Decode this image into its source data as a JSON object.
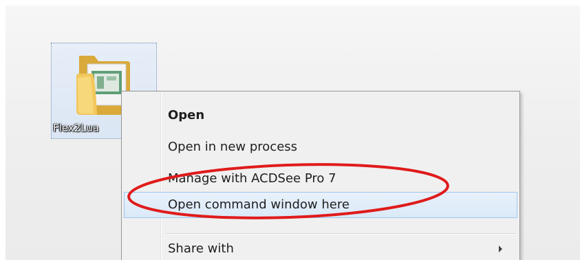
{
  "desktop": {
    "icon": {
      "label": "Flex2Lua",
      "icon": "folder-icon"
    }
  },
  "context_menu": {
    "items": [
      {
        "label": "Open",
        "bold": true
      },
      {
        "label": "Open in new process"
      },
      {
        "label": "Manage with ACDSee Pro 7"
      },
      {
        "label": "Open command window here",
        "highlighted": true
      },
      {
        "label": "Share with",
        "submenu": true
      }
    ]
  },
  "annotation": {
    "shape": "ellipse",
    "color": "#e01b1b",
    "target": "Open command window here"
  },
  "colors": {
    "menu_background": "#f0f0f0",
    "highlight_background": "#dbe9f8",
    "highlight_border": "#9ec6ef",
    "selection_frame": "#6f8fb8"
  }
}
